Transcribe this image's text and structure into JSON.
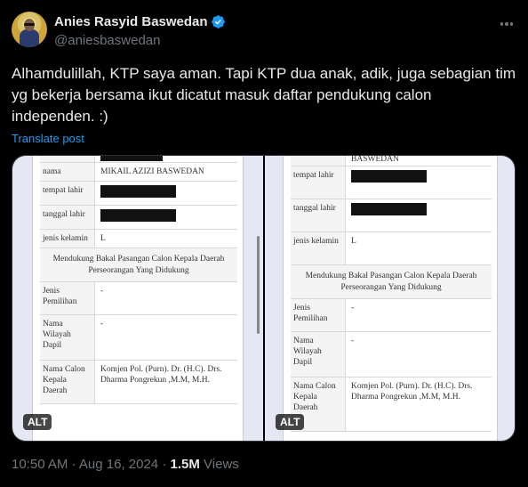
{
  "author": {
    "display_name": "Anies Rasyid Baswedan",
    "handle": "@aniesbaswedan"
  },
  "tweet": {
    "text": "Alhamdulillah, KTP saya aman. Tapi KTP dua anak, adik, juga sebagian tim yg bekerja bersama ikut dicatut masuk daftar pendukung calon independen. :)",
    "translate_label": "Translate post"
  },
  "media": {
    "alt_label": "ALT",
    "left": {
      "top_fragment": "",
      "rows": [
        {
          "k": "nama",
          "v": "MIKAIL AZIZI BASWEDAN"
        },
        {
          "k": "tempat lahir",
          "v": ""
        },
        {
          "k": "tanggal lahir",
          "v": ""
        },
        {
          "k": "jenis kelamin",
          "v": "L"
        }
      ],
      "section": "Mendukung Bakal Pasangan Calon Kepala Daerah Perseorangan Yang Didukung",
      "rows2": [
        {
          "k": "Jenis Pemilihan",
          "v": "-"
        },
        {
          "k": "Nama Wilayah Dapil",
          "v": "-"
        },
        {
          "k": "Nama Calon Kepala Daerah",
          "v": "Komjen Pol. (Purn). Dr. (H.C). Drs. Dharma Pongrekun ,M.M, M.H."
        }
      ]
    },
    "right": {
      "top_fragment": "BASWEDAN",
      "rows": [
        {
          "k": "tempat lahir",
          "v": ""
        },
        {
          "k": "tanggal lahir",
          "v": ""
        },
        {
          "k": "jenis kelamin",
          "v": "L"
        }
      ],
      "section": "Mendukung Bakal Pasangan Calon Kepala Daerah Perseorangan Yang Didukung",
      "rows2": [
        {
          "k": "Jenis Pemilihan",
          "v": "-"
        },
        {
          "k": "Nama Wilayah Dapil",
          "v": "-"
        },
        {
          "k": "Nama Calon Kepala Daerah",
          "v": "Komjen Pol. (Purn). Dr. (H.C). Drs. Dharma Pongrekun ,M.M, M.H."
        }
      ]
    }
  },
  "meta": {
    "time": "10:50 AM",
    "date": "Aug 16, 2024",
    "views_count": "1.5M",
    "views_label": "Views"
  },
  "colors": {
    "background": "#000000",
    "link": "#1d9bf0",
    "verified": "#1d9bf0",
    "muted": "#71767b"
  }
}
